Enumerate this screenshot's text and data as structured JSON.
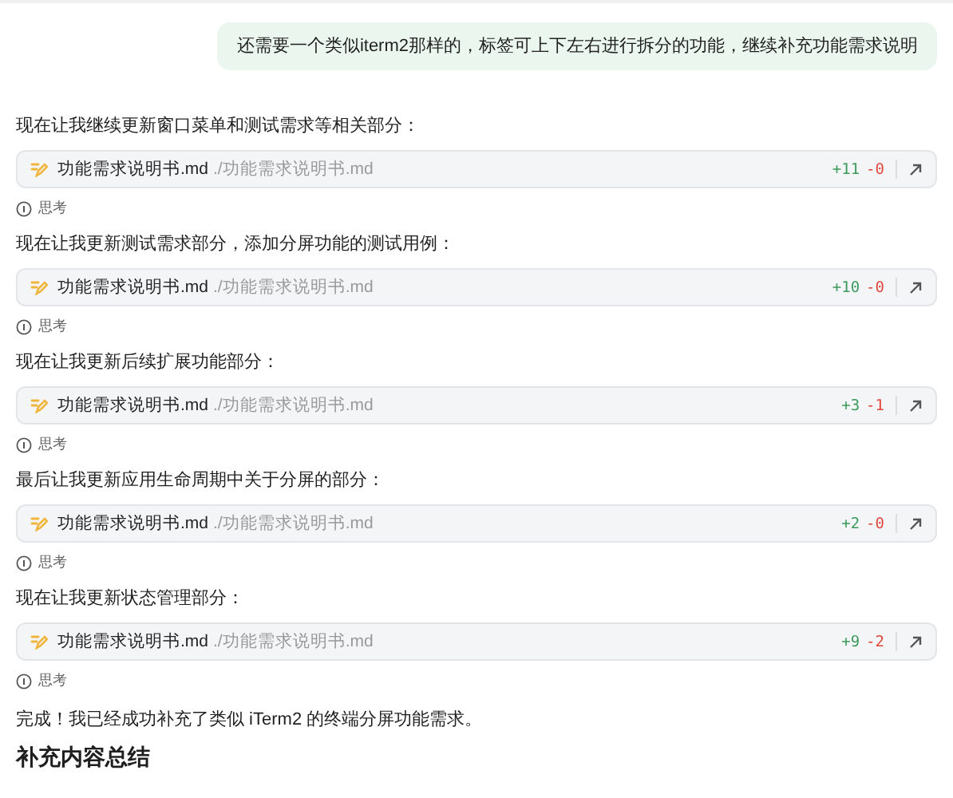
{
  "user_message": "还需要一个类似iterm2那样的，标签可上下左右进行拆分的功能，继续补充功能需求说明",
  "steps": [
    {
      "intro": "现在让我继续更新窗口菜单和测试需求等相关部分：",
      "file": {
        "name": "功能需求说明书.md",
        "path": "./功能需求说明书.md",
        "added": "+11",
        "removed": "-0"
      },
      "thinking": "思考"
    },
    {
      "intro": "现在让我更新测试需求部分，添加分屏功能的测试用例：",
      "file": {
        "name": "功能需求说明书.md",
        "path": "./功能需求说明书.md",
        "added": "+10",
        "removed": "-0"
      },
      "thinking": "思考"
    },
    {
      "intro": "现在让我更新后续扩展功能部分：",
      "file": {
        "name": "功能需求说明书.md",
        "path": "./功能需求说明书.md",
        "added": "+3",
        "removed": "-1"
      },
      "thinking": "思考"
    },
    {
      "intro": "最后让我更新应用生命周期中关于分屏的部分：",
      "file": {
        "name": "功能需求说明书.md",
        "path": "./功能需求说明书.md",
        "added": "+2",
        "removed": "-0"
      },
      "thinking": "思考"
    },
    {
      "intro": "现在让我更新状态管理部分：",
      "file": {
        "name": "功能需求说明书.md",
        "path": "./功能需求说明书.md",
        "added": "+9",
        "removed": "-2"
      },
      "thinking": "思考"
    }
  ],
  "conclusion": "完成！我已经成功补充了类似 iTerm2 的终端分屏功能需求。",
  "heading": "补充内容总结"
}
